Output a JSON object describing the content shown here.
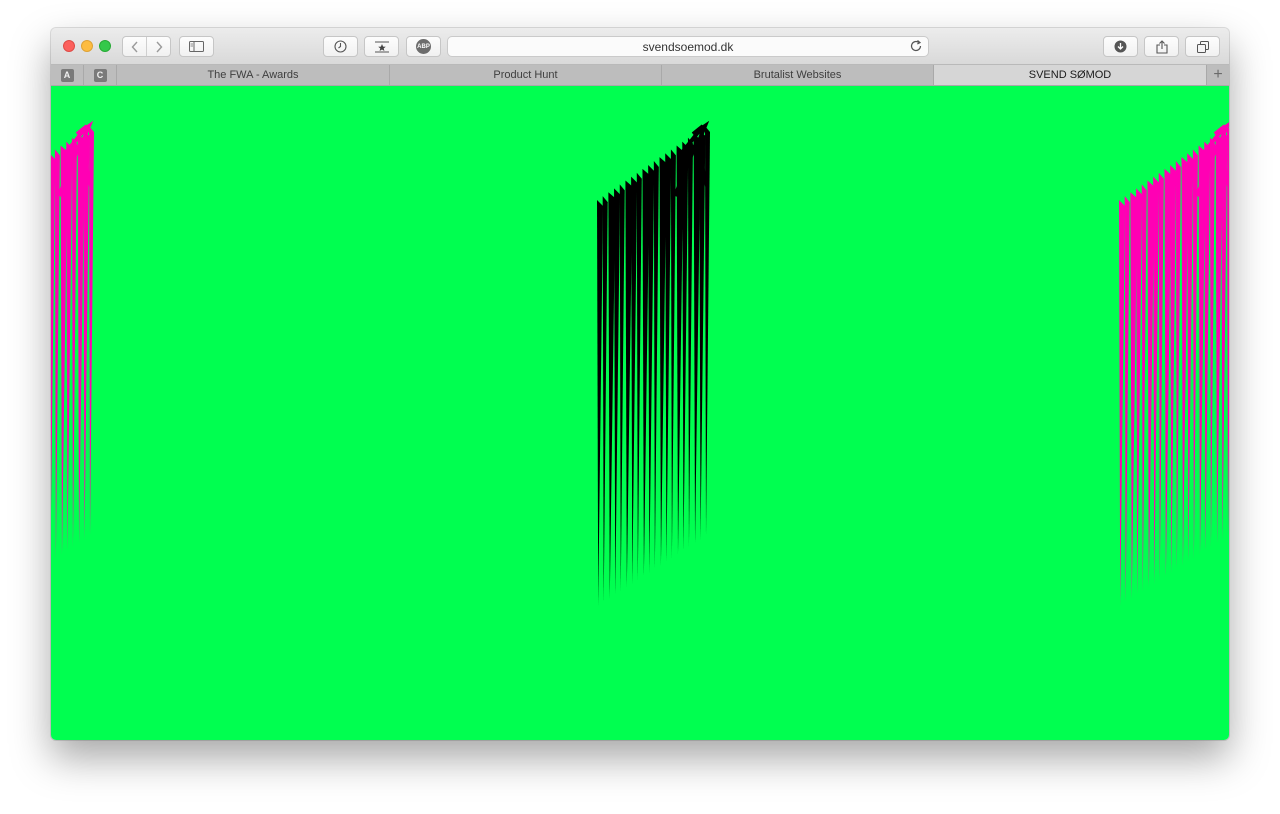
{
  "browser": {
    "url": "svendsoemod.dk",
    "pinned_tabs": [
      {
        "letter": "A"
      },
      {
        "letter": "C"
      }
    ],
    "tabs": [
      {
        "title": "The FWA - Awards",
        "active": false
      },
      {
        "title": "Product Hunt",
        "active": false
      },
      {
        "title": "Brutalist Websites",
        "active": false
      },
      {
        "title": "SVEND SØMOD",
        "active": true
      }
    ],
    "new_tab_label": "+",
    "adblock_label": "ABP"
  },
  "page": {
    "background_color": "#00ff50",
    "graphics": [
      {
        "name": "pink-zigzag-left",
        "color": "#ff00b4"
      },
      {
        "name": "black-zigzag-center",
        "color": "#000000"
      },
      {
        "name": "pink-zigzag-right",
        "color": "#ff00b4"
      }
    ]
  }
}
